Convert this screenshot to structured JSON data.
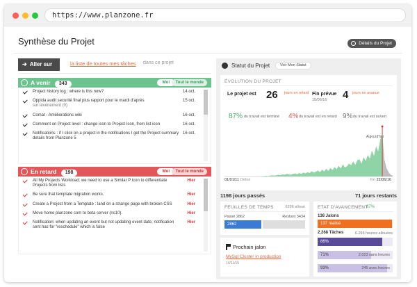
{
  "browser": {
    "url": "https://www.planzone.fr"
  },
  "page": {
    "title": "Synthèse du Projet",
    "details_button": "Détails du Projet"
  },
  "nav": {
    "aller_sur": "Aller sur",
    "link_all_tasks": "la liste de toutes mes tâches",
    "in_project": "dans ce projet"
  },
  "a_venir": {
    "label": "A venir",
    "count": "343",
    "filter_me": "Moi",
    "filter_all": "Tout le monde",
    "scroll_fraction": 0.35,
    "items": [
      {
        "text": "Project history log : where is this now?",
        "date": "14 oct.",
        "sub": ""
      },
      {
        "text": "Oppida audit securité final plus rapport pour le mardi d'après",
        "date": "15 oct.",
        "sub": "sur lévénement (0)"
      },
      {
        "text": "Comat - Améliorations wiki",
        "date": "16 oct.",
        "sub": ""
      },
      {
        "text": "Comment on Project level : change icon to Project Icon, from list icon",
        "date": "16 oct.",
        "sub": ""
      },
      {
        "text": "Notifications : if I click on a project in the notifications I get the Project summary details from Planzone 5",
        "date": "16 oct.",
        "sub": ""
      }
    ]
  },
  "en_retard": {
    "label": "En retard",
    "count": "198",
    "filter_me": "Moi",
    "filter_all": "Tout le monde",
    "scroll_fraction": 0.45,
    "items": [
      {
        "text": "All My Projects Workload: we need to use a Similar P icon to differentiate Projects from lists",
        "date": "Hier"
      },
      {
        "text": "Be sure that template migration works.",
        "date": "Hier"
      },
      {
        "text": "Create a Project from a Template : land on a strange page with broken CSS",
        "date": "Hier"
      },
      {
        "text": "Move home planzone com to beta server (ns10).",
        "date": "Hier"
      },
      {
        "text": "Notification: when updating an event but not updating event date, notification sent has for \"reschedule\" which is false",
        "date": "Hier"
      }
    ]
  },
  "statut": {
    "title": "Statut du Projet",
    "voir_button": "Voir Mon Statut",
    "evolution_title": "ÉVOLUTION DU PROJET",
    "projet_est": "Le projet est",
    "retard_days": "26",
    "retard_label": "jours en retard",
    "fin_prevue": "Fin prévue",
    "fin_date": "15/06/16",
    "avance_days": "4",
    "avance_label": "jours en avance",
    "pct_done": "87%",
    "pct_done_label": "du travail est terminé",
    "pct_late": "4%",
    "pct_late_label": "du travail est en retard",
    "pct_open": "9%",
    "pct_open_label": "du travail est ouvert",
    "aujourdhui": "Aujourd'hui",
    "start_date": "01/01/11",
    "start_label": "Début",
    "end_label": "Fin",
    "end_date": "22/06/16",
    "days_passed": "1198 jours passés",
    "days_left": "71 jours restants",
    "colors": {
      "done": "#49a96b",
      "late": "#e2585a",
      "open": "#777777",
      "area": "#8fd4a6"
    }
  },
  "chart_data": {
    "type": "area",
    "title": "",
    "series": [
      {
        "name": "",
        "values": [
          0,
          0,
          0,
          0,
          0,
          0,
          0,
          0,
          0,
          0,
          0,
          0,
          0,
          0,
          0,
          0,
          0,
          0,
          1,
          1,
          2,
          1,
          2,
          3,
          2,
          3,
          4,
          3,
          5,
          4,
          6,
          5,
          4,
          6,
          7,
          5,
          8,
          6,
          9,
          7,
          10,
          8,
          12,
          9,
          11,
          14,
          10,
          16,
          12,
          18,
          13,
          20,
          15,
          22,
          17,
          25,
          19,
          28,
          21,
          24,
          30,
          26,
          35,
          27,
          38,
          40,
          30,
          45,
          36,
          50,
          42,
          60,
          48,
          70,
          58,
          85,
          100,
          40,
          20,
          10,
          4,
          2
        ]
      }
    ],
    "ylim": [
      0,
      100
    ],
    "today_index": 76,
    "grid": false
  },
  "feuilles": {
    "title": "FEUILLES DE TEMPS",
    "alloue": "6296 alloué",
    "passe_label": "Passé 2862",
    "restant_label": "Restant 3434",
    "passe_value": "2862",
    "passe": 2862,
    "total": 6296
  },
  "prochain": {
    "title": "Prochain jalon",
    "link": "MySql Cluster in production",
    "date": "14/11/15"
  },
  "avancement": {
    "title": "ETAT D'AVANCEMENT",
    "pct": "87%",
    "jalons_label": "138 Jalons",
    "jalons_value": "137 réalisé",
    "jalons_fraction": 0.99,
    "taches_label": "2.268 Tâches",
    "taches_right": "6.296 heures allouées",
    "rows": [
      {
        "pct": "86%",
        "fraction": 0.86,
        "right": "",
        "color": "#5a4a9a"
      },
      {
        "pct": "71%",
        "fraction": 0.71,
        "right": "2.023 sans heures",
        "color": "#c9c1e3"
      },
      {
        "pct": "93%",
        "fraction": 0.93,
        "right": "245 avec heures",
        "color": "#c9c1e3"
      }
    ],
    "colors": {
      "jalons": "#f07022"
    }
  }
}
